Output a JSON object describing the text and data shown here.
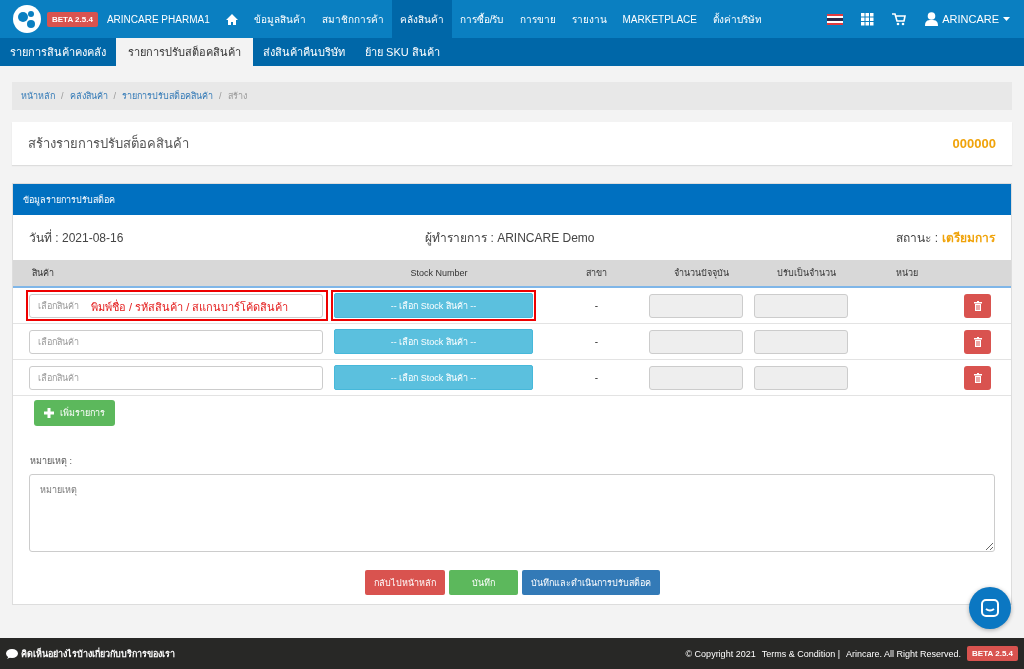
{
  "navbar": {
    "badge": "BETA 2.5.4",
    "brand": "ARINCARE PHARMA1",
    "menu": [
      {
        "kind": "home",
        "selected": false
      },
      {
        "kind": "text",
        "label": "ข้อมูลสินค้า",
        "selected": false
      },
      {
        "kind": "text",
        "label": "สมาชิกการค้า",
        "selected": false
      },
      {
        "kind": "text",
        "label": "คลังสินค้า",
        "selected": true
      },
      {
        "kind": "text",
        "label": "การซื้อ/รับ",
        "selected": false
      },
      {
        "kind": "text",
        "label": "การขาย",
        "selected": false
      },
      {
        "kind": "text",
        "label": "รายงาน",
        "selected": false
      },
      {
        "kind": "text",
        "label": "MARKETPLACE",
        "selected": false
      },
      {
        "kind": "text",
        "label": "ตั้งค่าบริษัท",
        "selected": false
      }
    ],
    "user": "ARINCARE"
  },
  "subnav": [
    {
      "label": "รายการสินค้าคงคลัง",
      "selected": false
    },
    {
      "label": "รายการปรับสต็อคสินค้า",
      "selected": true
    },
    {
      "label": "ส่งสินค้าคืนบริษัท",
      "selected": false
    },
    {
      "label": "ย้าย SKU สินค้า",
      "selected": false
    }
  ],
  "breadcrumb": {
    "separator": "/",
    "items": [
      "หน้าหลัก",
      "คลังสินค้า",
      "รายการปรับสต็อคสินค้า",
      "สร้าง"
    ]
  },
  "page_title": "สร้างรายการปรับสต็อคสินค้า",
  "document_number": "000000",
  "panel": {
    "title": "ข้อมูลรายการปรับสต็อค",
    "date_label": "วันที่ : 2021-08-16",
    "creator_label": "ผู้ทำรายการ : ARINCARE Demo",
    "status_label": "สถานะ :",
    "status_value": "เตรียมการ",
    "table": {
      "columns": [
        "สินค้า",
        "Stock Number",
        "สาขา",
        "จำนวนปัจจุบัน",
        "ปรับเป็นจำนวน",
        "หน่วย"
      ],
      "rows": [
        {
          "product_placeholder": "เลือกสินค้า",
          "annotation": "พิมพ์ชื่อ / รหัสสินค้า / สแกนบาร์โค้ดสินค้า",
          "stock_button": "-- เลือก Stock สินค้า --",
          "branch": "-",
          "highlighted": true
        },
        {
          "product_placeholder": "เลือกสินค้า",
          "stock_button": "-- เลือก Stock สินค้า --",
          "branch": "-",
          "highlighted": false
        },
        {
          "product_placeholder": "เลือกสินค้า",
          "stock_button": "-- เลือก Stock สินค้า --",
          "branch": "-",
          "highlighted": false
        }
      ]
    },
    "add_button": "เพิ่มรายการ",
    "remarks_label": "หมายเหตุ :",
    "remarks_placeholder": "หมายเหตุ",
    "buttons": [
      {
        "kind": "danger",
        "label": "กลับไปหน้าหลัก"
      },
      {
        "kind": "success",
        "label": "บันทึก"
      },
      {
        "kind": "primary",
        "label": "บันทึกและดำเนินการปรับสต็อค"
      }
    ]
  },
  "footer": {
    "feedback": "คิดเห็นอย่างไรบ้างเกี่ยวกับบริการของเรา",
    "copyright": "© Copyright 2021",
    "terms": "Terms & Condition |",
    "rights": "Arincare. All Right Reserved.",
    "badge": "BETA 2.5.4"
  }
}
